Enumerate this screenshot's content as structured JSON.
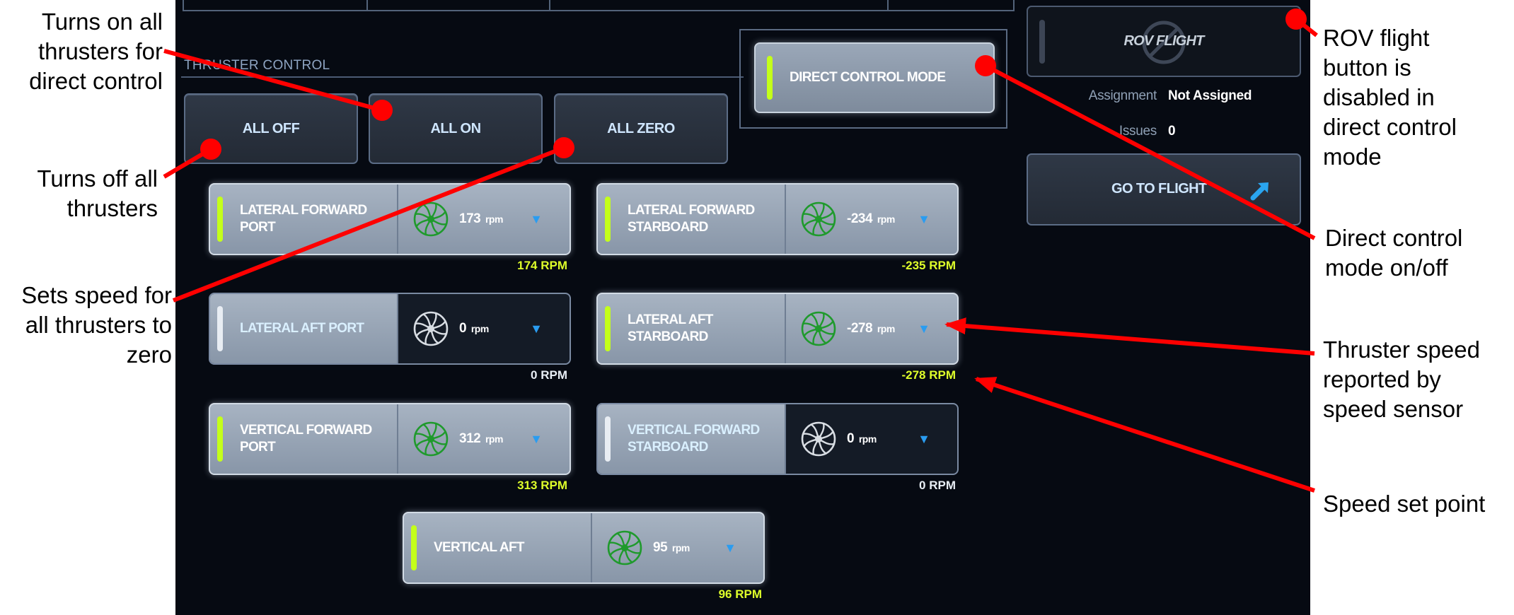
{
  "section": {
    "label": "THRUSTER CONTROL"
  },
  "group_buttons": {
    "all_off": "ALL OFF",
    "all_on": "ALL ON",
    "all_zero": "ALL ZERO"
  },
  "direct_control": {
    "label": "DIRECT CONTROL MODE",
    "active": true
  },
  "thrusters": [
    {
      "name": "LATERAL FORWARD PORT",
      "speed": "173",
      "unit": "rpm",
      "setpoint": "174 RPM",
      "on": true
    },
    {
      "name": "LATERAL FORWARD STARBOARD",
      "speed": "-234",
      "unit": "rpm",
      "setpoint": "-235 RPM",
      "on": true
    },
    {
      "name": "LATERAL AFT PORT",
      "speed": "0",
      "unit": "rpm",
      "setpoint": "0 RPM",
      "on": false
    },
    {
      "name": "LATERAL AFT STARBOARD",
      "speed": "-278",
      "unit": "rpm",
      "setpoint": "-278 RPM",
      "on": true
    },
    {
      "name": "VERTICAL FORWARD PORT",
      "speed": "312",
      "unit": "rpm",
      "setpoint": "313 RPM",
      "on": true
    },
    {
      "name": "VERTICAL FORWARD STARBOARD",
      "speed": "0",
      "unit": "rpm",
      "setpoint": "0 RPM",
      "on": false
    },
    {
      "name": "VERTICAL AFT",
      "speed": "95",
      "unit": "rpm",
      "setpoint": "96 RPM",
      "on": true
    }
  ],
  "rov_flight": {
    "label": "ROV FLIGHT",
    "enabled": false
  },
  "status": {
    "assignment_key": "Assignment",
    "assignment_value": "Not Assigned",
    "issues_key": "Issues",
    "issues_value": "0"
  },
  "goto_flight": {
    "label": "GO TO FLIGHT"
  },
  "annotations": {
    "all_on": [
      "Turns on all",
      "thrusters for",
      "direct control"
    ],
    "all_off": [
      "Turns off all",
      "thrusters"
    ],
    "all_zero": [
      "Sets speed for",
      "all thrusters to",
      "zero"
    ],
    "rov_flight": [
      "ROV flight",
      "button is",
      "disabled in",
      "direct control",
      "mode"
    ],
    "direct_mode": [
      "Direct control",
      "mode on/off"
    ],
    "speed_sensor": [
      "Thruster speed",
      "reported by",
      "speed sensor"
    ],
    "set_point": [
      "Speed set point"
    ]
  },
  "colors": {
    "background": "#060a12",
    "active_indicator": "#c4ff1a",
    "annotation_arrow": "#ff0000",
    "dropdown": "#2a9cf0",
    "fan_on": "#1f9a2c",
    "fan_off": "#d8dde3"
  }
}
